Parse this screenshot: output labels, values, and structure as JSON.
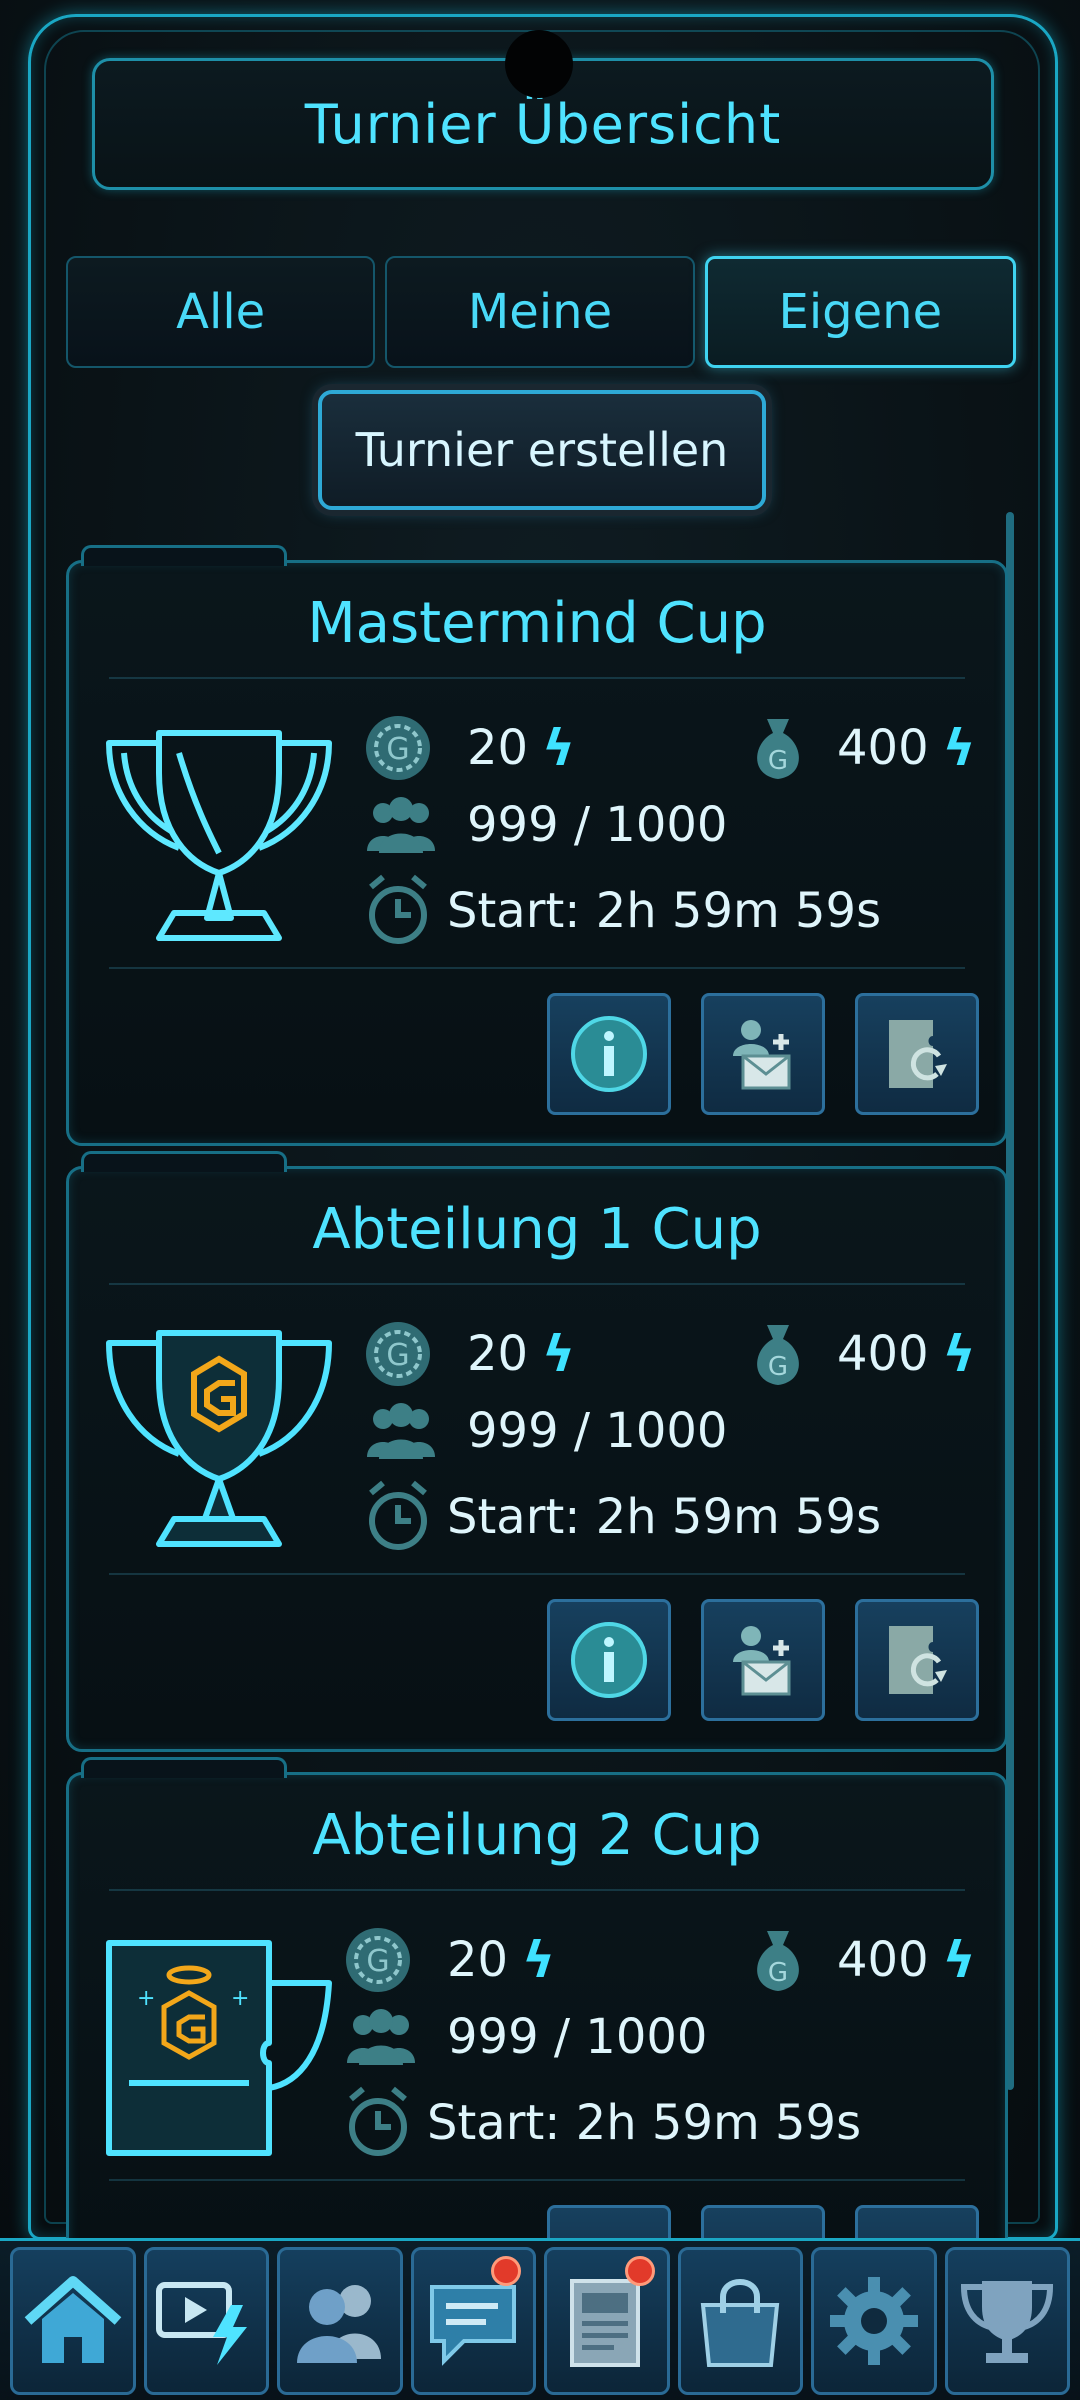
{
  "header": {
    "title": "Turnier Übersicht"
  },
  "tabs": [
    {
      "label": "Alle",
      "active": false
    },
    {
      "label": "Meine",
      "active": false
    },
    {
      "label": "Eigene",
      "active": true
    }
  ],
  "create_button": {
    "label": "Turnier erstellen"
  },
  "cards": [
    {
      "title": "Mastermind Cup",
      "fee": "20",
      "prize": "400",
      "players": "999 / 1000",
      "start": "Start: 2h 59m 59s",
      "trophy_icon": "outline-trophy-icon"
    },
    {
      "title": "Abteilung 1 Cup",
      "fee": "20",
      "prize": "400",
      "players": "999 / 1000",
      "start": "Start: 2h 59m 59s",
      "trophy_icon": "g-trophy-icon"
    },
    {
      "title": "Abteilung 2 Cup",
      "fee": "20",
      "prize": "400",
      "players": "999 / 1000",
      "start": "Start: 2h 59m 59s",
      "trophy_icon": "g-mug-trophy-icon"
    }
  ],
  "bolt_symbol": "ϟ",
  "colors": {
    "accent": "#4fe3ff",
    "frame": "#1aa7c4",
    "badge": "#e23a2a",
    "gold": "#f2a71a"
  },
  "bottom_nav": [
    {
      "icon": "home-icon",
      "badge": false
    },
    {
      "icon": "video-bolt-icon",
      "badge": false
    },
    {
      "icon": "friends-icon",
      "badge": false
    },
    {
      "icon": "chat-icon",
      "badge": true
    },
    {
      "icon": "news-icon",
      "badge": true
    },
    {
      "icon": "shop-bag-icon",
      "badge": false
    },
    {
      "icon": "settings-gear-icon",
      "badge": false
    },
    {
      "icon": "trophy-icon",
      "badge": false
    }
  ]
}
